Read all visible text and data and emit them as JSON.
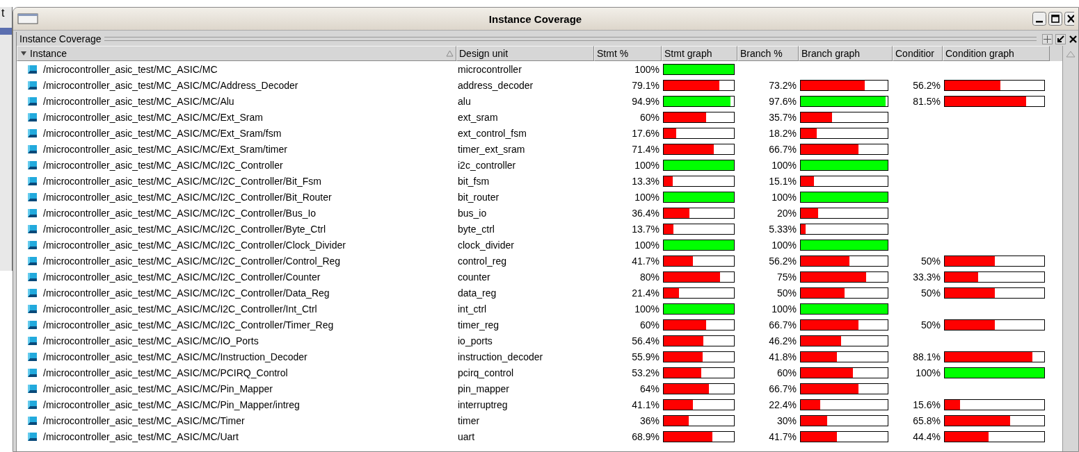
{
  "background_window": {
    "text": "t"
  },
  "window": {
    "title": "Instance Coverage"
  },
  "pane": {
    "title": "Instance Coverage"
  },
  "columns": [
    "Instance",
    "Design unit",
    "Stmt %",
    "Stmt graph",
    "Branch %",
    "Branch graph",
    "Conditior",
    "Condition graph"
  ],
  "rows": [
    {
      "instance": "/microcontroller_asic_test/MC_ASIC/MC",
      "design_unit": "microcontroller",
      "stmt": {
        "reading": "100%",
        "level": 1
      }
    },
    {
      "instance": "/microcontroller_asic_test/MC_ASIC/MC/Address_Decoder",
      "design_unit": "address_decoder",
      "stmt": {
        "reading": "79.1%",
        "level": 0.791
      },
      "branch": {
        "reading": "73.2%",
        "level": 0.732
      },
      "condition": {
        "reading": "56.2%",
        "level": 0.562
      }
    },
    {
      "instance": "/microcontroller_asic_test/MC_ASIC/MC/Alu",
      "design_unit": "alu",
      "stmt": {
        "reading": "94.9%",
        "level": 0.949
      },
      "branch": {
        "reading": "97.6%",
        "level": 0.976
      },
      "condition": {
        "reading": "81.5%",
        "level": 0.815
      }
    },
    {
      "instance": "/microcontroller_asic_test/MC_ASIC/MC/Ext_Sram",
      "design_unit": "ext_sram",
      "stmt": {
        "reading": "60%",
        "level": 0.6
      },
      "branch": {
        "reading": "35.7%",
        "level": 0.357
      }
    },
    {
      "instance": "/microcontroller_asic_test/MC_ASIC/MC/Ext_Sram/fsm",
      "design_unit": "ext_control_fsm",
      "stmt": {
        "reading": "17.6%",
        "level": 0.176
      },
      "branch": {
        "reading": "18.2%",
        "level": 0.182
      }
    },
    {
      "instance": "/microcontroller_asic_test/MC_ASIC/MC/Ext_Sram/timer",
      "design_unit": "timer_ext_sram",
      "stmt": {
        "reading": "71.4%",
        "level": 0.714
      },
      "branch": {
        "reading": "66.7%",
        "level": 0.667
      }
    },
    {
      "instance": "/microcontroller_asic_test/MC_ASIC/MC/I2C_Controller",
      "design_unit": "i2c_controller",
      "stmt": {
        "reading": "100%",
        "level": 1
      },
      "branch": {
        "reading": "100%",
        "level": 1
      }
    },
    {
      "instance": "/microcontroller_asic_test/MC_ASIC/MC/I2C_Controller/Bit_Fsm",
      "design_unit": "bit_fsm",
      "stmt": {
        "reading": "13.3%",
        "level": 0.133
      },
      "branch": {
        "reading": "15.1%",
        "level": 0.151
      }
    },
    {
      "instance": "/microcontroller_asic_test/MC_ASIC/MC/I2C_Controller/Bit_Router",
      "design_unit": "bit_router",
      "stmt": {
        "reading": "100%",
        "level": 1
      },
      "branch": {
        "reading": "100%",
        "level": 1
      }
    },
    {
      "instance": "/microcontroller_asic_test/MC_ASIC/MC/I2C_Controller/Bus_Io",
      "design_unit": "bus_io",
      "stmt": {
        "reading": "36.4%",
        "level": 0.364
      },
      "branch": {
        "reading": "20%",
        "level": 0.2
      }
    },
    {
      "instance": "/microcontroller_asic_test/MC_ASIC/MC/I2C_Controller/Byte_Ctrl",
      "design_unit": "byte_ctrl",
      "stmt": {
        "reading": "13.7%",
        "level": 0.137
      },
      "branch": {
        "reading": "5.33%",
        "level": 0.0533
      }
    },
    {
      "instance": "/microcontroller_asic_test/MC_ASIC/MC/I2C_Controller/Clock_Divider",
      "design_unit": "clock_divider",
      "stmt": {
        "reading": "100%",
        "level": 1
      },
      "branch": {
        "reading": "100%",
        "level": 1
      }
    },
    {
      "instance": "/microcontroller_asic_test/MC_ASIC/MC/I2C_Controller/Control_Reg",
      "design_unit": "control_reg",
      "stmt": {
        "reading": "41.7%",
        "level": 0.417
      },
      "branch": {
        "reading": "56.2%",
        "level": 0.562
      },
      "condition": {
        "reading": "50%",
        "level": 0.5
      }
    },
    {
      "instance": "/microcontroller_asic_test/MC_ASIC/MC/I2C_Controller/Counter",
      "design_unit": "counter",
      "stmt": {
        "reading": "80%",
        "level": 0.8
      },
      "branch": {
        "reading": "75%",
        "level": 0.75
      },
      "condition": {
        "reading": "33.3%",
        "level": 0.333
      }
    },
    {
      "instance": "/microcontroller_asic_test/MC_ASIC/MC/I2C_Controller/Data_Reg",
      "design_unit": "data_reg",
      "stmt": {
        "reading": "21.4%",
        "level": 0.214
      },
      "branch": {
        "reading": "50%",
        "level": 0.5
      },
      "condition": {
        "reading": "50%",
        "level": 0.5
      }
    },
    {
      "instance": "/microcontroller_asic_test/MC_ASIC/MC/I2C_Controller/Int_Ctrl",
      "design_unit": "int_ctrl",
      "stmt": {
        "reading": "100%",
        "level": 1
      },
      "branch": {
        "reading": "100%",
        "level": 1
      }
    },
    {
      "instance": "/microcontroller_asic_test/MC_ASIC/MC/I2C_Controller/Timer_Reg",
      "design_unit": "timer_reg",
      "stmt": {
        "reading": "60%",
        "level": 0.6
      },
      "branch": {
        "reading": "66.7%",
        "level": 0.667
      },
      "condition": {
        "reading": "50%",
        "level": 0.5
      }
    },
    {
      "instance": "/microcontroller_asic_test/MC_ASIC/MC/IO_Ports",
      "design_unit": "io_ports",
      "stmt": {
        "reading": "56.4%",
        "level": 0.564
      },
      "branch": {
        "reading": "46.2%",
        "level": 0.462
      }
    },
    {
      "instance": "/microcontroller_asic_test/MC_ASIC/MC/Instruction_Decoder",
      "design_unit": "instruction_decoder",
      "stmt": {
        "reading": "55.9%",
        "level": 0.559
      },
      "branch": {
        "reading": "41.8%",
        "level": 0.418
      },
      "condition": {
        "reading": "88.1%",
        "level": 0.881
      }
    },
    {
      "instance": "/microcontroller_asic_test/MC_ASIC/MC/PCIRQ_Control",
      "design_unit": "pcirq_control",
      "stmt": {
        "reading": "53.2%",
        "level": 0.532
      },
      "branch": {
        "reading": "60%",
        "level": 0.6
      },
      "condition": {
        "reading": "100%",
        "level": 1
      }
    },
    {
      "instance": "/microcontroller_asic_test/MC_ASIC/MC/Pin_Mapper",
      "design_unit": "pin_mapper",
      "stmt": {
        "reading": "64%",
        "level": 0.64
      },
      "branch": {
        "reading": "66.7%",
        "level": 0.667
      }
    },
    {
      "instance": "/microcontroller_asic_test/MC_ASIC/MC/Pin_Mapper/intreg",
      "design_unit": "interruptreg",
      "stmt": {
        "reading": "41.1%",
        "level": 0.411
      },
      "branch": {
        "reading": "22.4%",
        "level": 0.224
      },
      "condition": {
        "reading": "15.6%",
        "level": 0.156
      }
    },
    {
      "instance": "/microcontroller_asic_test/MC_ASIC/MC/Timer",
      "design_unit": "timer",
      "stmt": {
        "reading": "36%",
        "level": 0.36
      },
      "branch": {
        "reading": "30%",
        "level": 0.3
      },
      "condition": {
        "reading": "65.8%",
        "level": 0.658
      }
    },
    {
      "instance": "/microcontroller_asic_test/MC_ASIC/MC/Uart",
      "design_unit": "uart",
      "stmt": {
        "reading": "68.9%",
        "level": 0.689
      },
      "branch": {
        "reading": "41.7%",
        "level": 0.417
      },
      "condition": {
        "reading": "44.4%",
        "level": 0.444
      }
    }
  ]
}
